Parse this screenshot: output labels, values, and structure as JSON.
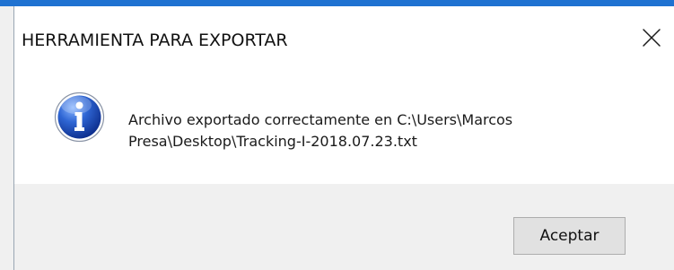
{
  "window": {
    "title": "HERRAMIENTA PARA EXPORTAR",
    "close_icon": "close-icon"
  },
  "message": {
    "text": "Archivo exportado correctamente en C:\\Users\\Marcos\nPresa\\Desktop\\Tracking-I-2018.07.23.txt",
    "icon": "info-icon"
  },
  "buttons": {
    "ok_label": "Aceptar"
  },
  "colors": {
    "accent": "#1f72d1",
    "footer_bg": "#f0f0f0",
    "button_bg": "#e1e1e1",
    "button_border": "#adadad",
    "icon_blue": "#1f4fb8"
  }
}
